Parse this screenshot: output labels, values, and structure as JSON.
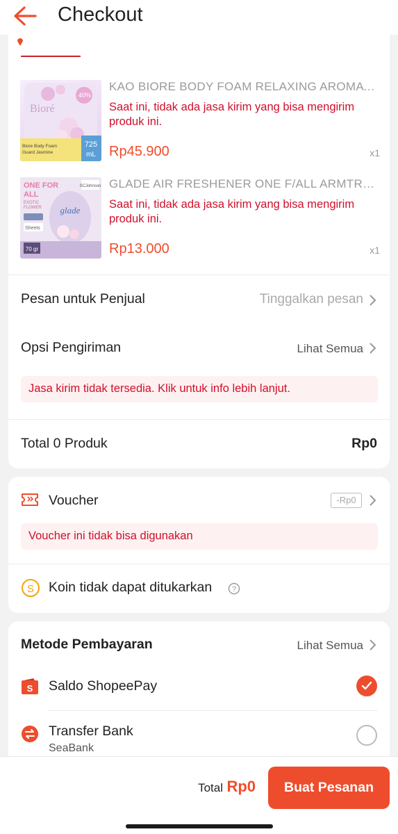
{
  "header": {
    "title": "Checkout"
  },
  "products": [
    {
      "name": "KAO BIORE BODY FOAM RELAXING AROMATIC ...",
      "warning": "Saat ini, tidak ada jasa kirim yang bisa mengirim produk ini.",
      "price": "Rp45.900",
      "qty": "x1",
      "thumb": {
        "brand": "Bioré",
        "caption": "Biore Body Foam Guard Jasmine",
        "size": "725 mL"
      }
    },
    {
      "name": "GLADE AIR FRESHENER ONE F/ALL ARMTRP E...",
      "warning": "Saat ini, tidak ada jasa kirim yang bisa mengirim produk ini.",
      "price": "Rp13.000",
      "qty": "x1",
      "thumb": {
        "headline": "ONE FOR ALL",
        "variant": "EXOTIC FLOWER",
        "weight": "70 gr",
        "brand": "glade"
      }
    }
  ],
  "seller_message": {
    "label": "Pesan untuk Penjual",
    "placeholder": "Tinggalkan pesan"
  },
  "shipping": {
    "label": "Opsi Pengiriman",
    "link": "Lihat Semua",
    "alert": "Jasa kirim tidak tersedia. Klik untuk info lebih lanjut."
  },
  "order_total": {
    "label": "Total 0 Produk",
    "value": "Rp0"
  },
  "voucher": {
    "label": "Voucher",
    "chip": "-Rp0",
    "alert": "Voucher ini tidak bisa digunakan"
  },
  "coins": {
    "label": "Koin tidak dapat ditukarkan"
  },
  "payment": {
    "title": "Metode Pembayaran",
    "link": "Lihat Semua",
    "methods": [
      {
        "label": "Saldo ShopeePay",
        "selected": true
      },
      {
        "label": "Transfer Bank",
        "sub": "SeaBank",
        "selected": false
      }
    ]
  },
  "footer": {
    "total_label": "Total",
    "total_value": "Rp0",
    "order_button": "Buat Pesanan"
  },
  "colors": {
    "accent": "#ee4d2d",
    "warning": "#d0102c",
    "alert_bg": "#fef1f1"
  }
}
